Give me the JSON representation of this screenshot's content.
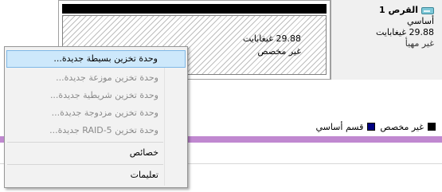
{
  "disk": {
    "name": "القرص 1",
    "type": "أساسي",
    "size": "29.88 غيغابايت",
    "status": "غير مهيأ"
  },
  "partition": {
    "size": "29.88 غيغابايت",
    "status": "غير مخصص"
  },
  "legend": {
    "items": [
      {
        "label": "غير مخصص",
        "color": "#000000"
      },
      {
        "label": "قسم أساسي",
        "color": "#000080"
      }
    ]
  },
  "context_menu": {
    "items": [
      {
        "label": "وحدة تخزين بسيطة جديدة...",
        "state": "hover"
      },
      {
        "label": "وحدة تخزين موزعة جديدة...",
        "state": "disabled"
      },
      {
        "label": "وحدة تخزين شريطية جديدة...",
        "state": "disabled"
      },
      {
        "label": "وحدة تخزين مزدوجة جديدة...",
        "state": "disabled"
      },
      {
        "label": "وحدة تخزين RAID-5 جديدة...",
        "state": "disabled"
      },
      {
        "label": "خصائص",
        "state": "enabled"
      },
      {
        "label": "تعليمات",
        "state": "enabled"
      }
    ]
  }
}
